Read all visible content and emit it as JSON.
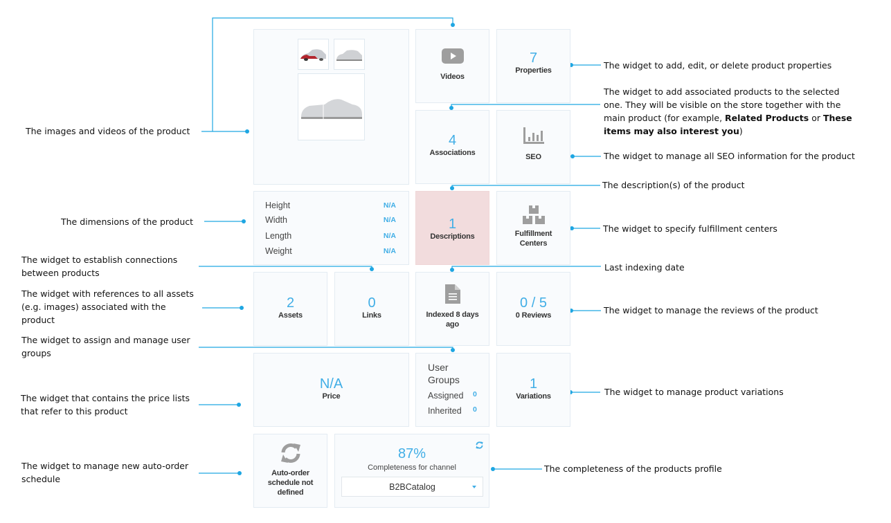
{
  "widgets": {
    "media": {
      "name": "Images and videos"
    },
    "videos": {
      "label": "Videos",
      "icon": "video-play-icon"
    },
    "properties": {
      "count": "7",
      "label": "Properties"
    },
    "associations": {
      "count": "4",
      "label": "Associations"
    },
    "seo": {
      "label": "SEO",
      "icon": "bar-chart-icon"
    },
    "dimensions": {
      "rows": [
        {
          "key": "Height",
          "value": "N/A"
        },
        {
          "key": "Width",
          "value": "N/A"
        },
        {
          "key": "Length",
          "value": "N/A"
        },
        {
          "key": "Weight",
          "value": "N/A"
        }
      ]
    },
    "descriptions": {
      "count": "1",
      "label": "Descriptions"
    },
    "fulfillment": {
      "label_line1": "Fulfillment",
      "label_line2": "Centers",
      "icon": "boxes-icon"
    },
    "assets": {
      "count": "2",
      "label": "Assets"
    },
    "links": {
      "count": "0",
      "label": "Links"
    },
    "indexed": {
      "label_line1": "Indexed 8 days",
      "label_line2": "ago",
      "icon": "document-icon"
    },
    "reviews": {
      "count": "0 / 5",
      "label": "0 Reviews"
    },
    "price": {
      "value": "N/A",
      "label": "Price"
    },
    "user_groups": {
      "title_line1": "User",
      "title_line2": "Groups",
      "rows": [
        {
          "key": "Assigned",
          "value": "0"
        },
        {
          "key": "Inherited",
          "value": "0"
        }
      ]
    },
    "variations": {
      "count": "1",
      "label": "Variations"
    },
    "auto_order": {
      "label_line1": "Auto-order",
      "label_line2": "schedule not",
      "label_line3": "defined",
      "icon": "refresh-icon"
    },
    "completeness": {
      "percent": "87%",
      "label": "Completeness for channel",
      "channel": "B2BCatalog",
      "icon": "refresh-icon"
    }
  },
  "annotations": {
    "media": "The images and videos of the product",
    "properties": "The widget to add, edit, or delete product properties",
    "associations": {
      "line1": "The widget to add associated products to the selected",
      "line2": "one. They will be visible on the store together with the",
      "line3_pre": "main product (for example, ",
      "bold1": "Related Products",
      "mid": " or ",
      "bold2a": "These",
      "bold2b": "items may also interest you",
      "end": ")"
    },
    "seo": "The widget to manage all SEO information for the product",
    "descriptions": "The description(s) of the product",
    "dimensions": "The dimensions of the product",
    "fulfillment": "The widget to specify fulfillment centers",
    "links": {
      "line1": "The widget to establish connections",
      "line2": "between products"
    },
    "indexed": "Last indexing date",
    "assets": {
      "line1": "The widget with references to all assets",
      "line2": "(e.g. images) associated with the",
      "line3": "product"
    },
    "reviews": "The widget to manage the reviews of the product",
    "user_groups": {
      "line1": "The widget to assign and manage user",
      "line2": "groups"
    },
    "price": {
      "line1": "The widget that contains the price lists",
      "line2": "that refer to this product"
    },
    "variations": "The widget to manage product variations",
    "auto_order": {
      "line1": "The widget to manage new auto-order",
      "line2": "schedule"
    },
    "completeness": "The completeness of the products profile"
  },
  "colors": {
    "accent": "#41aee6",
    "connector": "#1aa3e0",
    "highlight": "#f2dcdd"
  }
}
